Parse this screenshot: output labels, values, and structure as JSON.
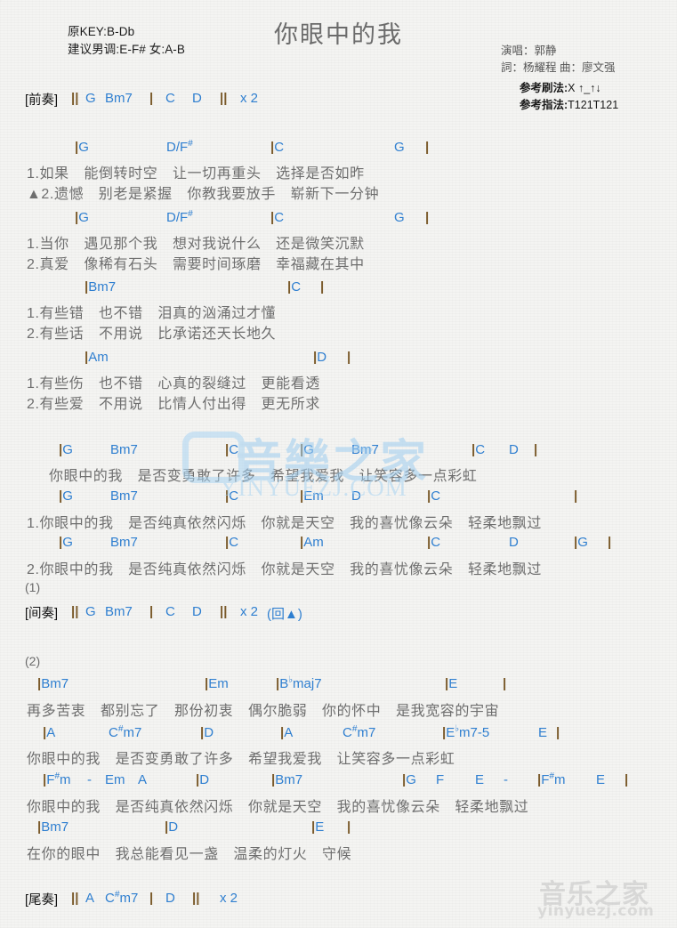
{
  "header": {
    "title": "你眼中的我",
    "orig_key": "原KEY:B-Db",
    "suggest_key": "建议男调:E-F# 女:A-B",
    "singer": "演唱：郭静",
    "writers": "詞：杨耀程  曲：廖文强",
    "strum_label": "参考刷法:",
    "strum_value": "X ↑_↑↓",
    "finger_label": "参考指法:",
    "finger_value": "T121T121"
  },
  "watermark": {
    "center_cjk": "音樂之家",
    "center_latin": "YINYUEZJ.COM",
    "corner_cjk": "音乐之家",
    "corner_latin": "yinyuezj.com"
  },
  "intro": {
    "section": "[前奏]",
    "tokens": [
      "||",
      "G",
      "Bm7",
      "|",
      "C",
      "D",
      "||",
      "x 2"
    ]
  },
  "interlude": {
    "marker": "(1)",
    "section": "[间奏]",
    "tokens": [
      "||",
      "G",
      "Bm7",
      "|",
      "C",
      "D",
      "||",
      "x 2",
      "(回▲)"
    ]
  },
  "section2_marker": "(2)",
  "outro": {
    "section": "[尾奏]",
    "tokens": [
      "||",
      "A",
      "C#m7",
      "|",
      "D",
      "||",
      "x 2"
    ]
  },
  "blocks": [
    {
      "id": "verse-a1",
      "chords": [
        "|G",
        "D/F#",
        "|C",
        "G",
        "|"
      ],
      "lyrics": [
        "1.如果　能倒转时空　让一切再重头　选择是否如昨",
        "▲2.遗憾　别老是紧握　你教我要放手　崭新下一分钟"
      ]
    },
    {
      "id": "verse-a2",
      "chords": [
        "|G",
        "D/F#",
        "|C",
        "G",
        "|"
      ],
      "lyrics": [
        "1.当你　遇见那个我　想对我说什么　还是微笑沉默",
        "2.真爱　像稀有石头　需要时间琢磨　幸福藏在其中"
      ]
    },
    {
      "id": "verse-b1",
      "chords": [
        "|Bm7",
        "|C",
        "|"
      ],
      "lyrics": [
        "1.有些错　也不错　泪真的汹涌过才懂",
        "2.有些话　不用说　比承诺还天长地久"
      ]
    },
    {
      "id": "verse-b2",
      "chords": [
        "|Am",
        "|D",
        "|"
      ],
      "lyrics": [
        "1.有些伤　也不错　心真的裂缝过　更能看透",
        "2.有些爱　不用说　比情人付出得　更无所求"
      ]
    },
    {
      "id": "chorus-1",
      "chords": [
        "|G",
        "Bm7",
        "|C",
        "|G",
        "Bm7",
        "|C",
        "D",
        "|"
      ],
      "lyrics": [
        "你眼中的我　是否变勇敢了许多　希望我爱我　让笑容多一点彩虹"
      ]
    },
    {
      "id": "chorus-2",
      "chords": [
        "|G",
        "Bm7",
        "|C",
        "|Em",
        "D",
        "|C",
        "|"
      ],
      "lyrics": [
        "1.你眼中的我　是否纯真依然闪烁　你就是天空　我的喜忧像云朵　轻柔地飘过"
      ]
    },
    {
      "id": "chorus-3",
      "chords": [
        "|G",
        "Bm7",
        "|C",
        "|Am",
        "|C",
        "D",
        "|G",
        "|"
      ],
      "lyrics": [
        "2.你眼中的我　是否纯真依然闪烁　你就是天空　我的喜忧像云朵　轻柔地飘过"
      ]
    },
    {
      "id": "bridge-1",
      "chords": [
        "|Bm7",
        "|Em",
        "|Bbmaj7",
        "|E",
        "|"
      ],
      "lyrics": [
        "再多苦衷　都别忘了　那份初衷　偶尔脆弱　你的怀中　是我宽容的宇宙"
      ]
    },
    {
      "id": "bridge-2",
      "chords": [
        "|A",
        "C#m7",
        "|D",
        "|A",
        "C#m7",
        "|Ebm7-5",
        "E",
        "|"
      ],
      "lyrics": [
        "你眼中的我　是否变勇敢了许多　希望我爱我　让笑容多一点彩虹"
      ]
    },
    {
      "id": "bridge-3",
      "chords": [
        "|F#m",
        "-",
        "Em",
        "A",
        "|D",
        "|Bm7",
        "|G",
        "F",
        "E",
        "-",
        "|F#m",
        "E",
        "|"
      ],
      "lyrics": [
        "你眼中的我　是否纯真依然闪烁　你就是天空　我的喜忧像云朵　轻柔地飘过"
      ]
    },
    {
      "id": "bridge-4",
      "chords": [
        "|Bm7",
        "|D",
        "|E",
        "|"
      ],
      "lyrics": [
        "在你的眼中　我总能看见一盏　温柔的灯火　守候"
      ]
    }
  ]
}
